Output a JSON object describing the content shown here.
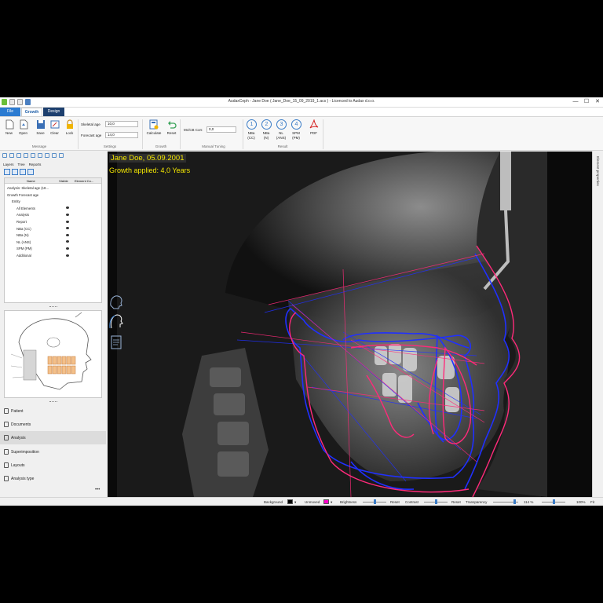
{
  "window": {
    "title": "AudaxCeph - Jane Doe ( Jane_Doe_15_09_2019_1.acs ) - Licenced to Audax d.o.o.",
    "controls": [
      "—",
      "☐",
      "✕"
    ]
  },
  "tabs": {
    "file": "File",
    "growth": "Growth",
    "design": "Design"
  },
  "ribbon": {
    "message": {
      "label": "Message",
      "buttons": [
        "New",
        "Open",
        "Save",
        "Clear",
        "Lock"
      ]
    },
    "settings": {
      "label": "Settings",
      "skeletal_age_label": "Skeletal age",
      "skeletal_age_value": "10,0",
      "forecast_age_label": "Forecast age",
      "forecast_age_value": "14,0"
    },
    "growth": {
      "label": "Growth",
      "calculate": "Calculate",
      "reset": "Reset"
    },
    "manual_tuning": {
      "label": "Manual Tuning",
      "mccb_label": "Mc/CB Corr.",
      "mccb_value": "0,0"
    },
    "result": {
      "label": "Result",
      "items": [
        {
          "num": "1",
          "line1": "NBa",
          "line2": "(CC)"
        },
        {
          "num": "2",
          "line1": "NBa",
          "line2": "(N)"
        },
        {
          "num": "3",
          "line1": "NL",
          "line2": "(ANS)"
        },
        {
          "num": "4",
          "line1": "SPM",
          "line2": "(PM)"
        }
      ],
      "pdf": "PDF"
    }
  },
  "left_panel": {
    "subtabs": [
      "Layers",
      "Tree",
      "Reports"
    ],
    "layers_header": {
      "name": "Name",
      "visible": "Visible",
      "element": "Element Co..."
    },
    "layers": [
      {
        "name": "Analysis: Skeletal age (18...",
        "indent": 0,
        "eye": false
      },
      {
        "name": "Growth Forecast age",
        "indent": 0,
        "eye": false
      },
      {
        "name": "Entity",
        "indent": 1,
        "eye": false
      },
      {
        "name": "All Elements",
        "indent": 2,
        "eye": true
      },
      {
        "name": "Analysis",
        "indent": 2,
        "eye": true
      },
      {
        "name": "Report",
        "indent": 2,
        "eye": true
      },
      {
        "name": "NBa (CC)",
        "indent": 2,
        "eye": true
      },
      {
        "name": "NBa (N)",
        "indent": 2,
        "eye": true
      },
      {
        "name": "NL (ANS)",
        "indent": 2,
        "eye": true
      },
      {
        "name": "SPM (PM)",
        "indent": 2,
        "eye": true
      },
      {
        "name": "Additional",
        "indent": 2,
        "eye": true
      }
    ],
    "nav": [
      "Patient",
      "Documents",
      "Analysis",
      "Superimposition",
      "Layouts",
      "Analysis type"
    ],
    "nav_active": "Analysis",
    "more": "•••"
  },
  "viewer": {
    "patient_caption": "Jane Doe, 05.09.2001",
    "growth_caption": "Growth applied: 4,0 Years"
  },
  "right_strip": {
    "label": "Element properties"
  },
  "statusbar": {
    "background_label": "Background",
    "background_color": "#000000",
    "unmoved_label": "Unmoved",
    "unmoved_color": "#ff00c8",
    "brightness_label": "Brightness",
    "reset1": "Reset",
    "contrast_label": "Contrast",
    "reset2": "Reset",
    "transparency_label": "Transparency",
    "zoom1": "114 %",
    "zoom2": "100%",
    "fit": "Fit"
  },
  "colors": {
    "accent": "#2b7bd1",
    "tracing_blue": "#2030ff",
    "tracing_pink": "#ff2a7a",
    "caption_yellow": "#f5e800"
  }
}
